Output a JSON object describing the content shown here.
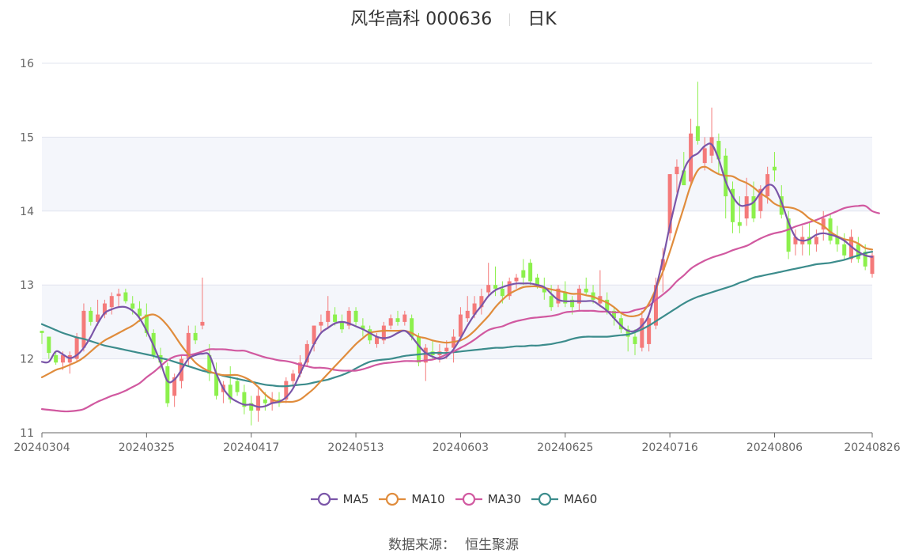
{
  "title": {
    "stock": "风华高科 000636",
    "period": "日K"
  },
  "source": {
    "label": "数据来源：",
    "value": "恒生聚源"
  },
  "colors": {
    "up": "#f47a7a",
    "down": "#8cf04c",
    "ma5": "#7a55a8",
    "ma10": "#e08c3c",
    "ma30": "#d159a0",
    "ma60": "#3c8c8c",
    "grid": "#e1e4ef",
    "band": "#f4f6fb"
  },
  "chart_data": {
    "type": "candlestick",
    "ylim": [
      11,
      16
    ],
    "yticks": [
      "11",
      "12",
      "13",
      "14",
      "15",
      "16"
    ],
    "xticks": [
      "20240304",
      "20240325",
      "20240417",
      "20240513",
      "20240603",
      "20240625",
      "20240716",
      "20240806",
      "20240826"
    ],
    "xtick_index": [
      0,
      15,
      30,
      45,
      60,
      75,
      90,
      105,
      119
    ],
    "ohlc": [
      [
        12.38,
        12.38,
        12.2,
        12.35
      ],
      [
        12.3,
        12.3,
        12.0,
        12.08
      ],
      [
        12.05,
        12.1,
        11.92,
        11.95
      ],
      [
        11.95,
        12.1,
        11.85,
        12.05
      ],
      [
        11.95,
        12.1,
        11.8,
        12.05
      ],
      [
        12.0,
        12.35,
        11.95,
        12.3
      ],
      [
        12.15,
        12.75,
        12.1,
        12.65
      ],
      [
        12.65,
        12.7,
        12.45,
        12.5
      ],
      [
        12.5,
        12.8,
        12.45,
        12.6
      ],
      [
        12.6,
        12.8,
        12.55,
        12.75
      ],
      [
        12.7,
        12.9,
        12.6,
        12.85
      ],
      [
        12.85,
        12.95,
        12.7,
        12.88
      ],
      [
        12.9,
        12.95,
        12.75,
        12.78
      ],
      [
        12.75,
        12.85,
        12.6,
        12.68
      ],
      [
        12.68,
        12.78,
        12.5,
        12.58
      ],
      [
        12.6,
        12.75,
        12.3,
        12.35
      ],
      [
        12.35,
        12.4,
        12.0,
        12.05
      ],
      [
        12.05,
        12.15,
        11.85,
        11.95
      ],
      [
        11.9,
        11.95,
        11.35,
        11.4
      ],
      [
        11.5,
        11.8,
        11.35,
        11.75
      ],
      [
        11.7,
        12.05,
        11.6,
        12.0
      ],
      [
        12.0,
        12.45,
        11.9,
        12.35
      ],
      [
        12.35,
        12.45,
        12.2,
        12.25
      ],
      [
        12.45,
        13.1,
        12.4,
        12.5
      ],
      [
        12.05,
        12.2,
        11.7,
        11.8
      ],
      [
        11.8,
        11.95,
        11.45,
        11.5
      ],
      [
        11.55,
        11.7,
        11.4,
        11.65
      ],
      [
        11.65,
        11.9,
        11.4,
        11.45
      ],
      [
        11.7,
        11.75,
        11.5,
        11.55
      ],
      [
        11.55,
        11.65,
        11.25,
        11.35
      ],
      [
        11.4,
        11.5,
        11.1,
        11.3
      ],
      [
        11.3,
        11.6,
        11.15,
        11.5
      ],
      [
        11.45,
        11.55,
        11.3,
        11.4
      ],
      [
        11.4,
        11.55,
        11.3,
        11.45
      ],
      [
        11.45,
        11.55,
        11.35,
        11.4
      ],
      [
        11.45,
        11.75,
        11.4,
        11.7
      ],
      [
        11.7,
        11.85,
        11.6,
        11.8
      ],
      [
        11.8,
        12.05,
        11.75,
        11.95
      ],
      [
        11.95,
        12.25,
        11.9,
        12.2
      ],
      [
        12.2,
        12.45,
        12.1,
        12.45
      ],
      [
        12.45,
        12.6,
        12.35,
        12.5
      ],
      [
        12.5,
        12.85,
        12.4,
        12.65
      ],
      [
        12.6,
        12.7,
        12.45,
        12.5
      ],
      [
        12.5,
        12.6,
        12.35,
        12.4
      ],
      [
        12.45,
        12.7,
        12.4,
        12.65
      ],
      [
        12.65,
        12.7,
        12.45,
        12.5
      ],
      [
        12.45,
        12.55,
        12.3,
        12.4
      ],
      [
        12.4,
        12.45,
        12.2,
        12.25
      ],
      [
        12.2,
        12.35,
        12.15,
        12.3
      ],
      [
        12.25,
        12.5,
        12.2,
        12.45
      ],
      [
        12.45,
        12.6,
        12.4,
        12.55
      ],
      [
        12.55,
        12.65,
        12.45,
        12.5
      ],
      [
        12.5,
        12.65,
        12.45,
        12.6
      ],
      [
        12.55,
        12.6,
        12.25,
        12.3
      ],
      [
        12.3,
        12.35,
        11.9,
        11.95
      ],
      [
        11.95,
        12.2,
        11.7,
        12.15
      ],
      [
        12.1,
        12.25,
        12.0,
        12.05
      ],
      [
        12.05,
        12.2,
        11.95,
        12.1
      ],
      [
        12.1,
        12.25,
        12.0,
        12.15
      ],
      [
        12.15,
        12.4,
        11.95,
        12.3
      ],
      [
        12.3,
        12.7,
        12.25,
        12.6
      ],
      [
        12.55,
        12.85,
        12.5,
        12.65
      ],
      [
        12.6,
        12.85,
        12.55,
        12.75
      ],
      [
        12.7,
        12.95,
        12.6,
        12.85
      ],
      [
        12.9,
        13.3,
        12.85,
        13.0
      ],
      [
        13.0,
        13.25,
        12.85,
        12.95
      ],
      [
        12.95,
        13.05,
        12.75,
        12.85
      ],
      [
        12.85,
        13.1,
        12.8,
        13.05
      ],
      [
        13.05,
        13.15,
        12.95,
        13.1
      ],
      [
        13.2,
        13.35,
        13.0,
        13.1
      ],
      [
        13.3,
        13.35,
        13.0,
        13.05
      ],
      [
        13.1,
        13.15,
        12.95,
        13.0
      ],
      [
        12.95,
        13.1,
        12.8,
        12.9
      ],
      [
        12.85,
        13.0,
        12.65,
        12.7
      ],
      [
        12.75,
        13.0,
        12.7,
        12.95
      ],
      [
        12.9,
        13.05,
        12.7,
        12.75
      ],
      [
        12.8,
        12.85,
        12.6,
        12.7
      ],
      [
        12.75,
        13.0,
        12.65,
        12.95
      ],
      [
        12.95,
        13.1,
        12.85,
        12.9
      ],
      [
        12.9,
        13.0,
        12.75,
        12.8
      ],
      [
        12.75,
        13.2,
        12.7,
        12.85
      ],
      [
        12.8,
        12.9,
        12.6,
        12.65
      ],
      [
        12.65,
        12.7,
        12.45,
        12.55
      ],
      [
        12.55,
        12.6,
        12.35,
        12.4
      ],
      [
        12.4,
        12.45,
        12.1,
        12.3
      ],
      [
        12.3,
        12.4,
        12.05,
        12.2
      ],
      [
        12.15,
        12.65,
        12.1,
        12.55
      ],
      [
        12.2,
        12.6,
        12.1,
        12.55
      ],
      [
        12.45,
        13.1,
        12.4,
        13.0
      ],
      [
        13.2,
        13.5,
        12.9,
        13.35
      ],
      [
        13.7,
        14.5,
        13.6,
        14.5
      ],
      [
        14.5,
        14.7,
        14.25,
        14.6
      ],
      [
        14.55,
        14.8,
        14.4,
        14.35
      ],
      [
        14.4,
        15.25,
        14.35,
        15.05
      ],
      [
        15.15,
        15.75,
        14.9,
        14.95
      ],
      [
        14.65,
        15.0,
        14.55,
        14.85
      ],
      [
        14.75,
        15.4,
        14.65,
        15.0
      ],
      [
        14.95,
        15.05,
        14.5,
        14.7
      ],
      [
        14.75,
        14.85,
        13.9,
        14.2
      ],
      [
        14.3,
        14.4,
        13.7,
        13.85
      ],
      [
        13.85,
        14.2,
        13.7,
        13.8
      ],
      [
        13.9,
        14.45,
        13.8,
        14.2
      ],
      [
        14.2,
        14.4,
        13.85,
        13.9
      ],
      [
        14.0,
        14.35,
        13.9,
        14.3
      ],
      [
        14.2,
        14.6,
        14.1,
        14.5
      ],
      [
        14.6,
        14.8,
        14.4,
        14.55
      ],
      [
        14.2,
        14.35,
        13.9,
        13.95
      ],
      [
        13.9,
        14.0,
        13.35,
        13.45
      ],
      [
        13.55,
        13.75,
        13.4,
        13.65
      ],
      [
        13.55,
        13.8,
        13.4,
        13.65
      ],
      [
        13.65,
        13.85,
        13.4,
        13.55
      ],
      [
        13.55,
        13.75,
        13.45,
        13.65
      ],
      [
        13.75,
        14.0,
        13.6,
        13.9
      ],
      [
        13.9,
        13.95,
        13.55,
        13.6
      ],
      [
        13.65,
        13.8,
        13.45,
        13.55
      ],
      [
        13.55,
        13.7,
        13.35,
        13.4
      ],
      [
        13.35,
        13.75,
        13.3,
        13.65
      ],
      [
        13.55,
        13.65,
        13.3,
        13.35
      ],
      [
        13.45,
        13.55,
        13.2,
        13.25
      ],
      [
        13.15,
        13.45,
        13.1,
        13.4
      ]
    ],
    "series": [
      {
        "name": "MA5",
        "values": [
          11.96,
          11.96,
          12.1,
          12.06,
          12.01,
          12.05,
          12.15,
          12.3,
          12.48,
          12.62,
          12.67,
          12.7,
          12.7,
          12.65,
          12.55,
          12.38,
          12.18,
          11.95,
          11.7,
          11.72,
          11.85,
          12.0,
          12.05,
          12.07,
          12.05,
          11.8,
          11.6,
          11.48,
          11.42,
          11.38,
          11.38,
          11.35,
          11.36,
          11.4,
          11.42,
          11.48,
          11.6,
          11.8,
          12.0,
          12.2,
          12.35,
          12.42,
          12.48,
          12.5,
          12.48,
          12.44,
          12.4,
          12.35,
          12.3,
          12.28,
          12.3,
          12.35,
          12.38,
          12.3,
          12.18,
          12.08,
          12.03,
          12.0,
          12.03,
          12.13,
          12.28,
          12.45,
          12.6,
          12.72,
          12.85,
          12.93,
          12.97,
          13.0,
          13.02,
          13.02,
          13.02,
          13.0,
          12.97,
          12.88,
          12.8,
          12.78,
          12.78,
          12.78,
          12.78,
          12.78,
          12.72,
          12.65,
          12.55,
          12.45,
          12.38,
          12.38,
          12.45,
          12.6,
          12.95,
          13.35,
          13.8,
          14.2,
          14.55,
          14.72,
          14.78,
          14.88,
          14.9,
          14.7,
          14.4,
          14.2,
          14.08,
          14.08,
          14.12,
          14.25,
          14.35,
          14.32,
          14.12,
          13.85,
          13.65,
          13.6,
          13.62,
          13.68,
          13.7,
          13.68,
          13.65,
          13.6,
          13.52,
          13.45,
          13.4,
          13.38
        ]
      },
      {
        "name": "MA10",
        "values": [
          11.75,
          11.8,
          11.85,
          11.88,
          11.92,
          11.96,
          12.02,
          12.1,
          12.18,
          12.25,
          12.3,
          12.35,
          12.4,
          12.45,
          12.52,
          12.58,
          12.6,
          12.55,
          12.45,
          12.32,
          12.18,
          12.06,
          11.95,
          11.88,
          11.83,
          11.8,
          11.78,
          11.78,
          11.78,
          11.75,
          11.7,
          11.62,
          11.52,
          11.45,
          11.42,
          11.42,
          11.42,
          11.45,
          11.52,
          11.6,
          11.7,
          11.8,
          11.9,
          12.0,
          12.1,
          12.2,
          12.28,
          12.35,
          12.37,
          12.38,
          12.38,
          12.38,
          12.38,
          12.35,
          12.3,
          12.28,
          12.25,
          12.23,
          12.22,
          12.23,
          12.25,
          12.3,
          12.38,
          12.48,
          12.58,
          12.7,
          12.8,
          12.88,
          12.93,
          12.97,
          12.98,
          12.98,
          12.96,
          12.94,
          12.92,
          12.9,
          12.88,
          12.88,
          12.86,
          12.84,
          12.8,
          12.76,
          12.7,
          12.62,
          12.58,
          12.58,
          12.62,
          12.75,
          12.95,
          13.18,
          13.45,
          13.75,
          14.05,
          14.35,
          14.55,
          14.6,
          14.55,
          14.5,
          14.48,
          14.47,
          14.42,
          14.38,
          14.32,
          14.24,
          14.18,
          14.1,
          14.06,
          14.05,
          14.03,
          13.98,
          13.9,
          13.85,
          13.8,
          13.72,
          13.66,
          13.62,
          13.6,
          13.56,
          13.5,
          13.48
        ]
      },
      {
        "name": "MA30",
        "values": [
          11.32,
          11.31,
          11.3,
          11.29,
          11.29,
          11.3,
          11.32,
          11.37,
          11.42,
          11.46,
          11.5,
          11.53,
          11.57,
          11.62,
          11.67,
          11.75,
          11.82,
          11.9,
          11.98,
          12.03,
          12.05,
          12.05,
          12.07,
          12.1,
          12.13,
          12.13,
          12.13,
          12.12,
          12.11,
          12.11,
          12.08,
          12.05,
          12.02,
          12.0,
          11.98,
          11.97,
          11.95,
          11.92,
          11.9,
          11.88,
          11.88,
          11.87,
          11.85,
          11.84,
          11.84,
          11.84,
          11.86,
          11.89,
          11.92,
          11.94,
          11.95,
          11.96,
          11.97,
          11.97,
          11.97,
          11.98,
          11.99,
          12.02,
          12.06,
          12.1,
          12.15,
          12.2,
          12.26,
          12.33,
          12.39,
          12.42,
          12.44,
          12.48,
          12.51,
          12.53,
          12.55,
          12.56,
          12.57,
          12.58,
          12.6,
          12.63,
          12.64,
          12.65,
          12.65,
          12.65,
          12.64,
          12.64,
          12.63,
          12.63,
          12.63,
          12.66,
          12.68,
          12.72,
          12.8,
          12.87,
          12.95,
          13.05,
          13.13,
          13.22,
          13.28,
          13.33,
          13.37,
          13.4,
          13.43,
          13.47,
          13.5,
          13.53,
          13.58,
          13.63,
          13.67,
          13.7,
          13.72,
          13.75,
          13.79,
          13.82,
          13.85,
          13.88,
          13.92,
          13.96,
          14.0,
          14.04,
          14.06,
          14.07,
          14.07,
          14.0,
          13.97
        ]
      },
      {
        "name": "MA60",
        "values": [
          12.47,
          12.43,
          12.39,
          12.35,
          12.32,
          12.29,
          12.27,
          12.24,
          12.21,
          12.18,
          12.16,
          12.14,
          12.12,
          12.1,
          12.08,
          12.06,
          12.04,
          12.01,
          11.99,
          11.96,
          11.93,
          11.9,
          11.87,
          11.84,
          11.82,
          11.8,
          11.77,
          11.75,
          11.73,
          11.71,
          11.69,
          11.67,
          11.65,
          11.64,
          11.63,
          11.63,
          11.64,
          11.65,
          11.66,
          11.68,
          11.7,
          11.72,
          11.75,
          11.78,
          11.82,
          11.87,
          11.92,
          11.96,
          11.98,
          11.99,
          12.0,
          12.02,
          12.04,
          12.05,
          12.06,
          12.07,
          12.08,
          12.08,
          12.08,
          12.09,
          12.1,
          12.11,
          12.12,
          12.13,
          12.14,
          12.15,
          12.15,
          12.16,
          12.17,
          12.17,
          12.18,
          12.18,
          12.19,
          12.2,
          12.22,
          12.24,
          12.27,
          12.29,
          12.3,
          12.3,
          12.3,
          12.3,
          12.31,
          12.32,
          12.33,
          12.36,
          12.4,
          12.45,
          12.51,
          12.57,
          12.63,
          12.69,
          12.75,
          12.8,
          12.84,
          12.87,
          12.9,
          12.93,
          12.96,
          12.99,
          13.03,
          13.06,
          13.1,
          13.12,
          13.14,
          13.16,
          13.18,
          13.2,
          13.22,
          13.24,
          13.26,
          13.28,
          13.29,
          13.3,
          13.32,
          13.34,
          13.37,
          13.4,
          13.43,
          13.45
        ]
      }
    ]
  }
}
